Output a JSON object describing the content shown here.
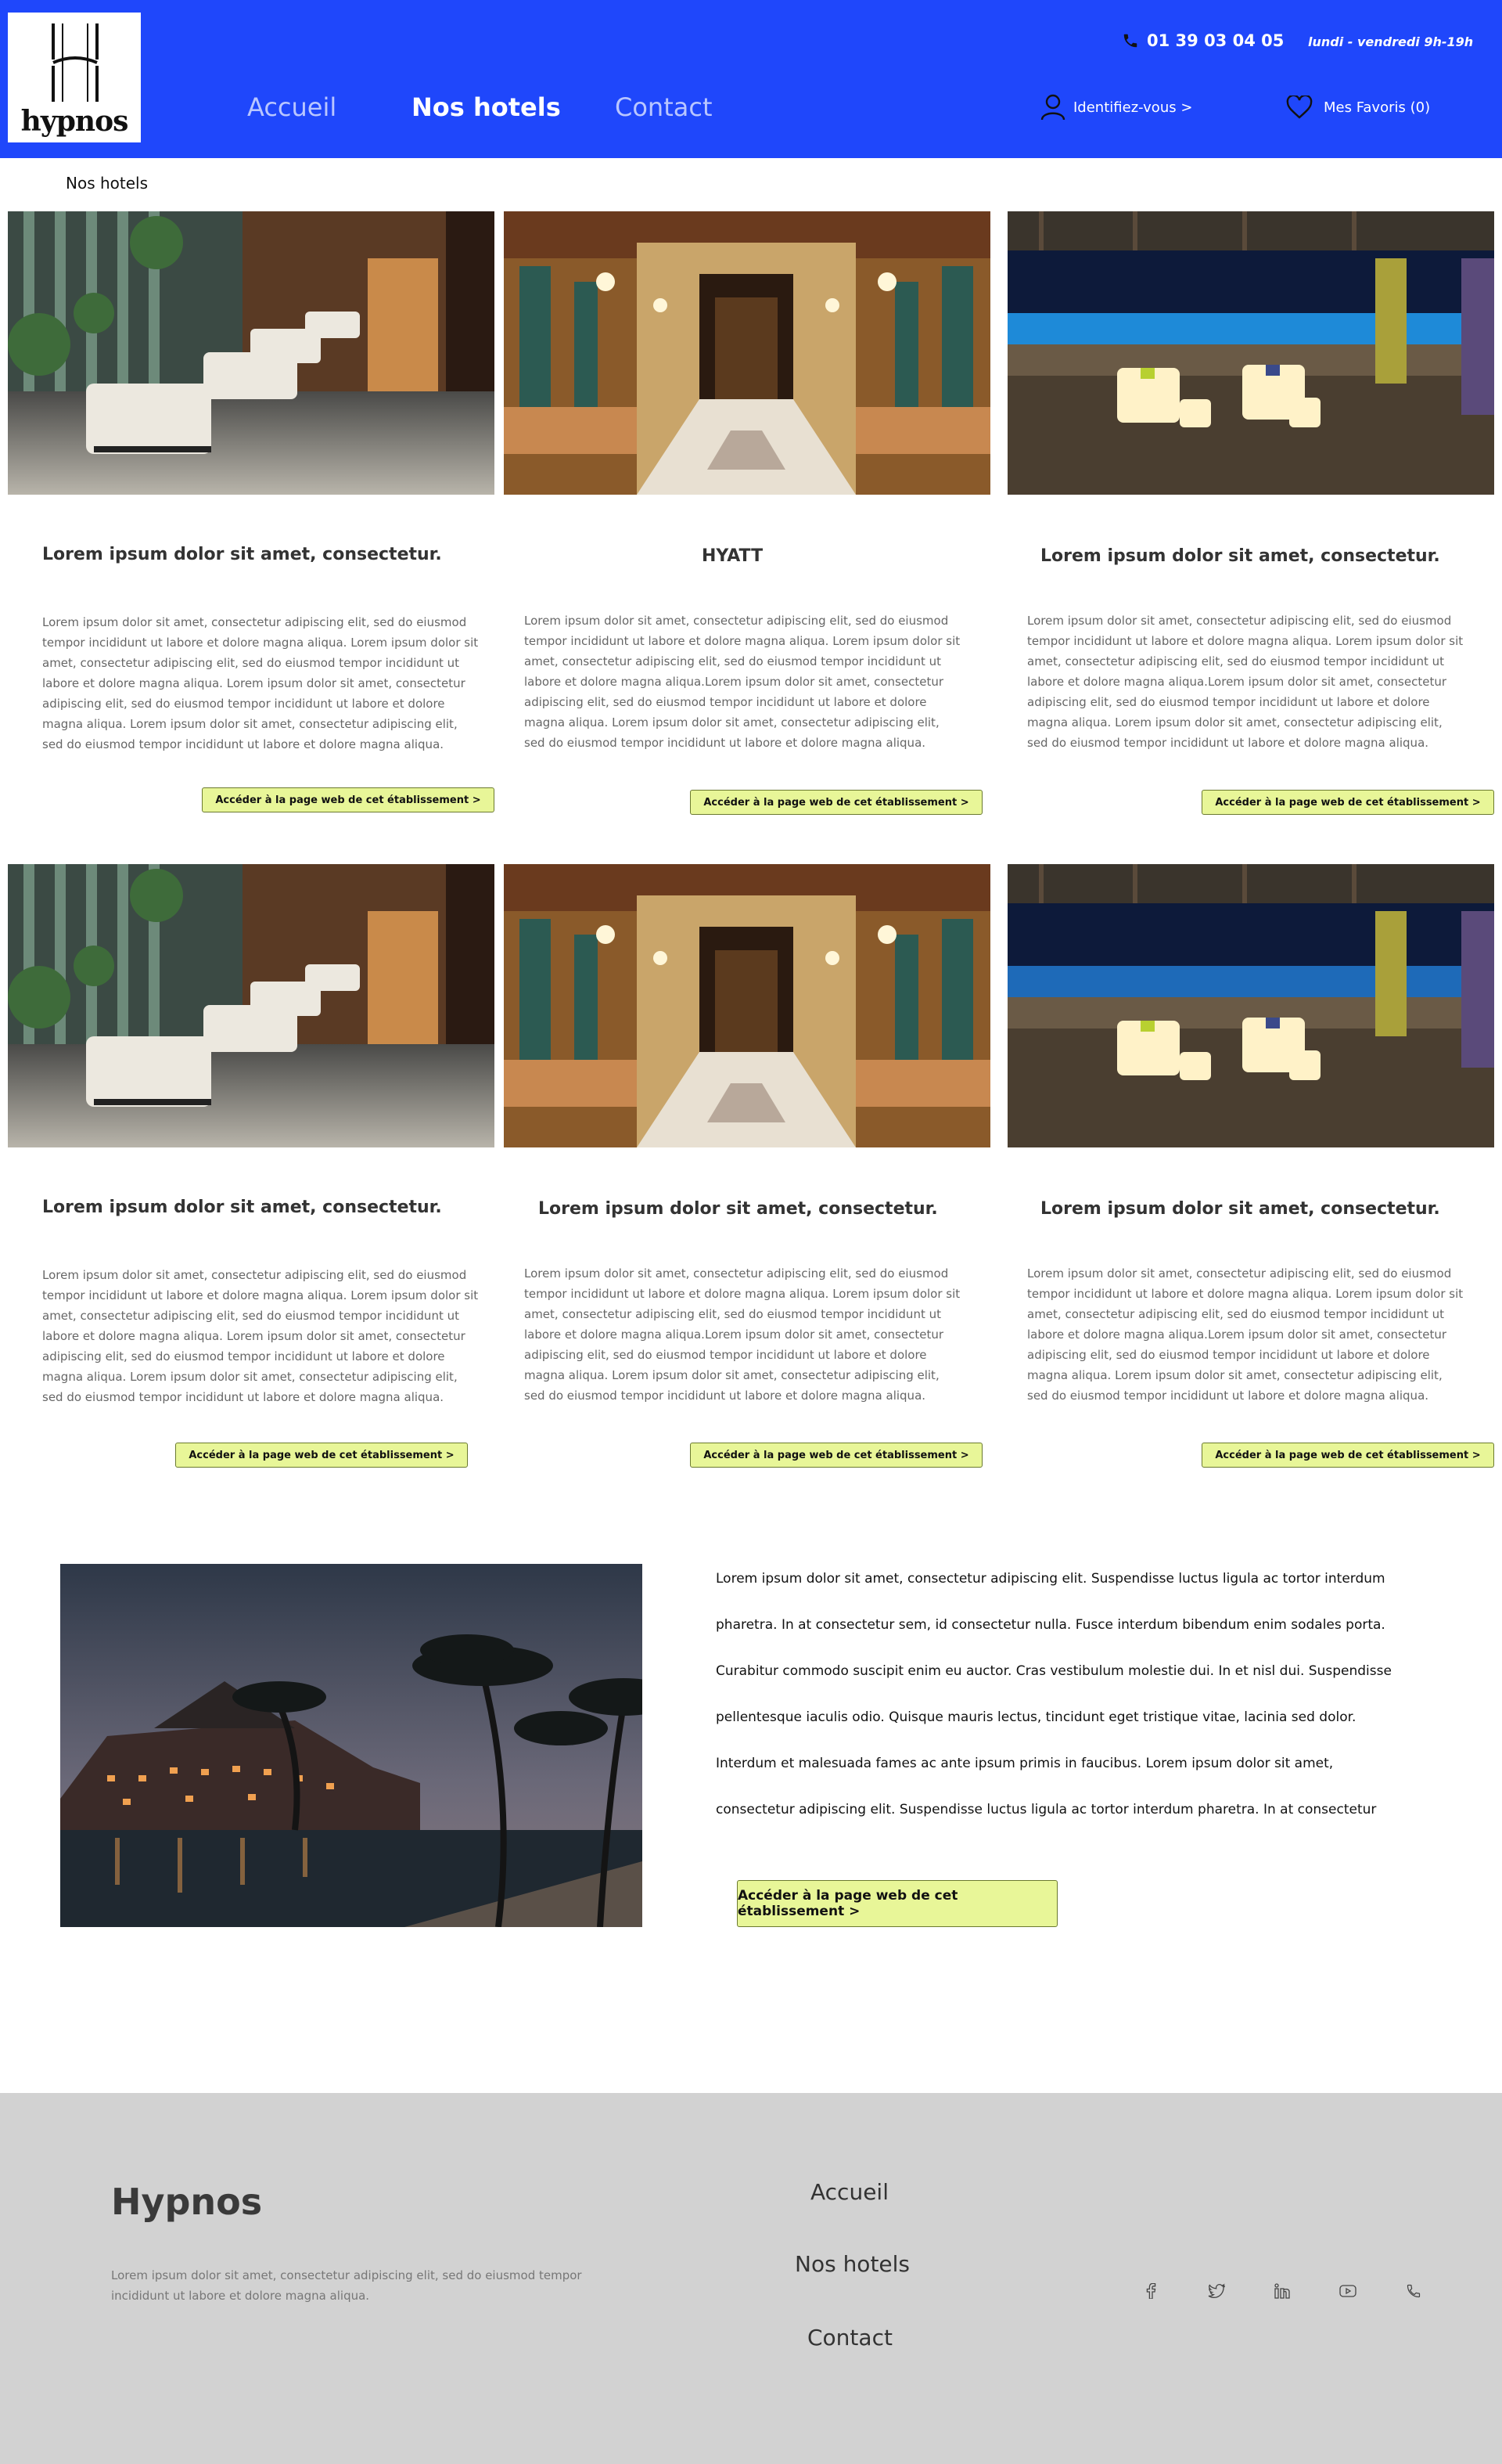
{
  "header": {
    "logo_text": "hypnos",
    "nav": {
      "home": "Accueil",
      "hotels": "Nos hotels",
      "contact": "Contact"
    },
    "phone": "01 39 03 04 05",
    "hours": "lundi - vendredi 9h-19h",
    "login": "Identifiez-vous >",
    "favorites": "Mes Favoris (0)"
  },
  "breadcrumb": "Nos hotels",
  "cards": [
    {
      "title": "Lorem ipsum dolor sit amet, consectetur.",
      "description": "Lorem ipsum dolor sit amet, consectetur adipiscing elit, sed do eiusmod tempor incididunt ut labore et dolore magna aliqua. Lorem ipsum dolor sit amet, consectetur adipiscing elit, sed do eiusmod tempor incididunt ut labore et dolore magna aliqua. Lorem ipsum dolor sit amet, consectetur adipiscing elit, sed do eiusmod tempor incididunt ut labore et dolore magna aliqua. Lorem ipsum dolor sit amet, consectetur adipiscing elit, sed do eiusmod tempor incididunt ut labore et dolore magna aliqua.",
      "button": "Accéder à la page web de cet établissement >"
    },
    {
      "title": "HYATT",
      "description": "Lorem ipsum dolor sit amet, consectetur adipiscing elit, sed do eiusmod tempor incididunt ut labore et dolore magna aliqua. Lorem ipsum dolor sit amet, consectetur adipiscing elit, sed do eiusmod tempor incididunt ut labore et dolore magna aliqua.Lorem ipsum dolor sit amet, consectetur adipiscing elit, sed do eiusmod tempor incididunt ut labore et dolore magna aliqua. Lorem ipsum dolor sit amet, consectetur adipiscing elit, sed do eiusmod tempor incididunt ut labore et dolore magna aliqua.",
      "button": "Accéder à la page web de cet établissement >"
    },
    {
      "title": "Lorem ipsum dolor sit amet, consectetur.",
      "description": "Lorem ipsum dolor sit amet, consectetur adipiscing elit, sed do eiusmod tempor incididunt ut labore et dolore magna aliqua. Lorem ipsum dolor sit amet, consectetur adipiscing elit, sed do eiusmod tempor incididunt ut labore et dolore magna aliqua.Lorem ipsum dolor sit amet, consectetur adipiscing elit, sed do eiusmod tempor incididunt ut labore et dolore magna aliqua. Lorem ipsum dolor sit amet, consectetur adipiscing elit, sed do eiusmod tempor incididunt ut labore et dolore magna aliqua.",
      "button": "Accéder à la page web de cet établissement >"
    },
    {
      "title": "Lorem ipsum dolor sit amet, consectetur.",
      "description": "Lorem ipsum dolor sit amet, consectetur adipiscing elit, sed do eiusmod tempor incididunt ut labore et dolore magna aliqua. Lorem ipsum dolor sit amet, consectetur adipiscing elit, sed do eiusmod tempor incididunt ut labore et dolore magna aliqua. Lorem ipsum dolor sit amet, consectetur adipiscing elit, sed do eiusmod tempor incididunt ut labore et dolore magna aliqua. Lorem ipsum dolor sit amet, consectetur adipiscing elit, sed do eiusmod tempor incididunt ut labore et dolore magna aliqua.",
      "button": "Accéder à la page web de cet établissement >"
    },
    {
      "title": "Lorem ipsum dolor sit amet, consectetur.",
      "description": "Lorem ipsum dolor sit amet, consectetur adipiscing elit, sed do eiusmod tempor incididunt ut labore et dolore magna aliqua. Lorem ipsum dolor sit amet, consectetur adipiscing elit, sed do eiusmod tempor incididunt ut labore et dolore magna aliqua.Lorem ipsum dolor sit amet, consectetur adipiscing elit, sed do eiusmod tempor incididunt ut labore et dolore magna aliqua. Lorem ipsum dolor sit amet, consectetur adipiscing elit, sed do eiusmod tempor incididunt ut labore et dolore magna aliqua.",
      "button": "Accéder à la page web de cet établissement >"
    },
    {
      "title": "Lorem ipsum dolor sit amet, consectetur.",
      "description": "Lorem ipsum dolor sit amet, consectetur adipiscing elit, sed do eiusmod tempor incididunt ut labore et dolore magna aliqua. Lorem ipsum dolor sit amet, consectetur adipiscing elit, sed do eiusmod tempor incididunt ut labore et dolore magna aliqua.Lorem ipsum dolor sit amet, consectetur adipiscing elit, sed do eiusmod tempor incididunt ut labore et dolore magna aliqua. Lorem ipsum dolor sit amet, consectetur adipiscing elit, sed do eiusmod tempor incididunt ut labore et dolore magna aliqua.",
      "button": "Accéder à la page web de cet établissement >"
    }
  ],
  "feature": {
    "text": "Lorem ipsum dolor sit amet, consectetur adipiscing elit. Suspendisse luctus ligula ac tortor interdum pharetra. In at consectetur sem, id consectetur nulla. Fusce interdum bibendum enim sodales porta. Curabitur commodo suscipit enim eu auctor. Cras vestibulum molestie dui. In et nisl dui. Suspendisse pellentesque iaculis odio. Quisque mauris lectus, tincidunt eget tristique vitae, lacinia sed dolor. Interdum et malesuada fames ac ante ipsum primis in faucibus. Lorem ipsum dolor sit amet, consectetur adipiscing elit. Suspendisse luctus ligula ac tortor interdum pharetra. In at consectetur",
    "button": "Accéder à la page web de cet établissement >"
  },
  "footer": {
    "brand": "Hypnos",
    "description": "Lorem ipsum dolor sit amet, consectetur adipiscing elit, sed do eiusmod tempor incididunt ut labore et dolore magna aliqua.",
    "links": {
      "home": "Accueil",
      "hotels": "Nos hotels",
      "contact": "Contact"
    },
    "social_icons": [
      "facebook-icon",
      "twitter-icon",
      "linkedin-icon",
      "youtube-icon",
      "phone-icon"
    ]
  },
  "colors": {
    "header_bg": "#1f47fb",
    "button_bg": "#e8f698",
    "footer_bg": "#d2d2d2"
  }
}
